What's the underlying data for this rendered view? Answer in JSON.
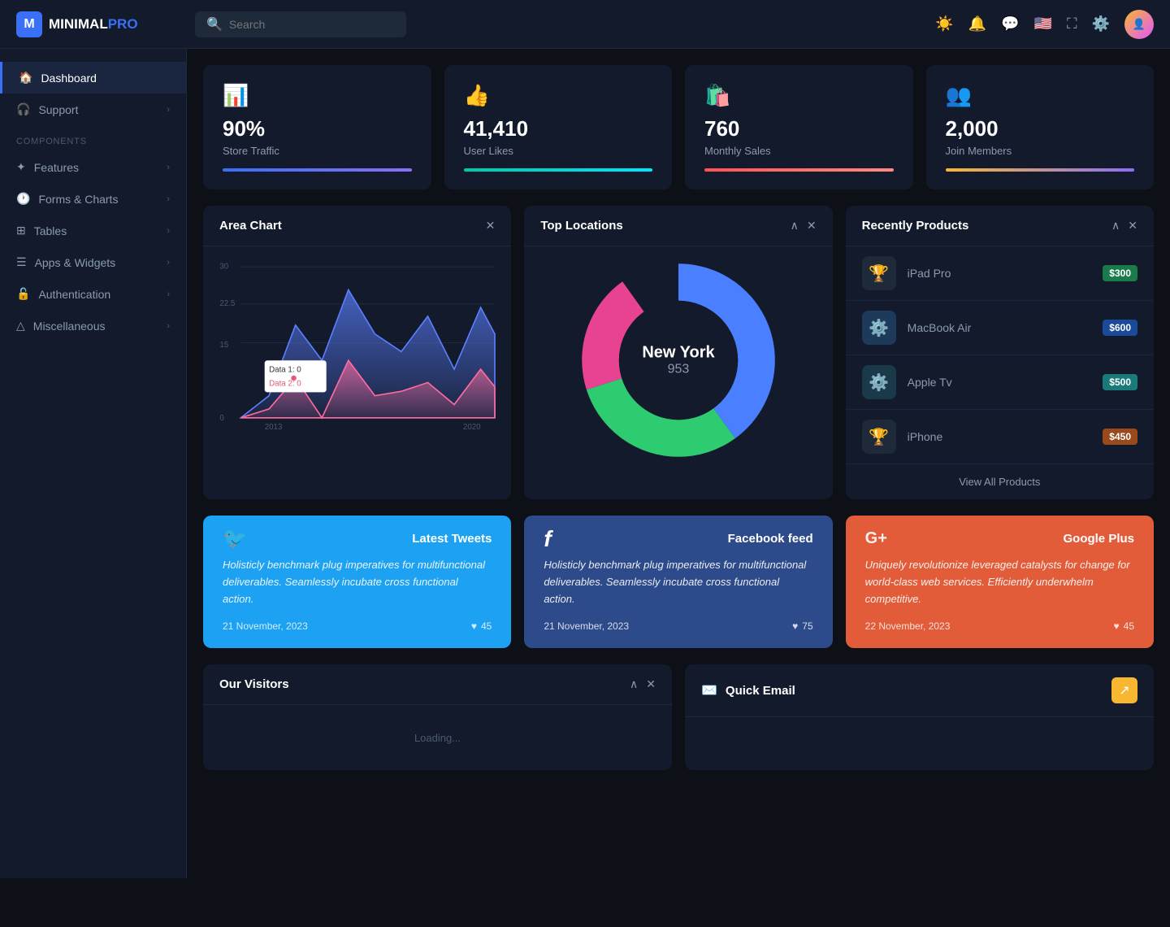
{
  "app": {
    "name_part1": "MINIMAL",
    "name_part2": "PRO"
  },
  "navbar": {
    "search_placeholder": "Search",
    "icons": [
      "☀️",
      "🔔",
      "💬",
      "🇺🇸",
      "⛶",
      "⚙️"
    ]
  },
  "sidebar": {
    "dashboard_label": "Dashboard",
    "support_label": "Support",
    "components_label": "Components",
    "features_label": "Features",
    "forms_charts_label": "Forms & Charts",
    "tables_label": "Tables",
    "apps_widgets_label": "Apps & Widgets",
    "authentication_label": "Authentication",
    "miscellaneous_label": "Miscellaneous"
  },
  "stats": [
    {
      "icon": "📊",
      "value": "90%",
      "label": "Store Traffic",
      "bar_color1": "#3a6ff7",
      "bar_color2": "#8a6ff7"
    },
    {
      "icon": "👍",
      "value": "41,410",
      "label": "User Likes",
      "bar_color1": "#00c9a7",
      "bar_color2": "#00e5ff"
    },
    {
      "icon": "🛍️",
      "value": "760",
      "label": "Monthly Sales",
      "bar_color1": "#ff5252",
      "bar_color2": "#ff8a80"
    },
    {
      "icon": "👥",
      "value": "2,000",
      "label": "Join Members",
      "bar_color1": "#f7b731",
      "bar_color2": "#8a6ff7"
    }
  ],
  "area_chart": {
    "title": "Area Chart",
    "year_label": "2013",
    "year_end": "2020",
    "tooltip_data1_label": "Data 1: 0",
    "tooltip_data2_label": "Data 2: 0",
    "y_labels": [
      "30",
      "22.5",
      "15",
      "0"
    ]
  },
  "top_locations": {
    "title": "Top Locations",
    "city": "New York",
    "city_value": "953"
  },
  "recently_products": {
    "title": "Recently Products",
    "view_all_label": "View All Products",
    "products": [
      {
        "icon": "🏆",
        "name": "iPad Pro",
        "price": "$300",
        "price_class": "price-green"
      },
      {
        "icon": "⚙️",
        "name": "MacBook Air",
        "price": "$600",
        "price_class": "price-blue"
      },
      {
        "icon": "⚙️",
        "name": "Apple Tv",
        "price": "$500",
        "price_class": "price-teal"
      },
      {
        "icon": "🏆",
        "name": "iPhone",
        "price": "$450",
        "price_class": "price-orange"
      }
    ]
  },
  "social_cards": [
    {
      "type": "twitter",
      "css_class": "twitter",
      "logo": "🐦",
      "title": "Latest Tweets",
      "text": "Holisticly benchmark plug imperatives for multifunctional deliverables. Seamlessly incubate cross functional action.",
      "date": "21 November, 2023",
      "likes": "45"
    },
    {
      "type": "facebook",
      "css_class": "facebook",
      "logo": "f",
      "title": "Facebook feed",
      "text": "Holisticly benchmark plug imperatives for multifunctional deliverables. Seamlessly incubate cross functional action.",
      "date": "21 November, 2023",
      "likes": "75"
    },
    {
      "type": "google",
      "css_class": "google",
      "logo": "G+",
      "title": "Google Plus",
      "text": "Uniquely revolutionize leveraged catalysts for change for world-class web services. Efficiently underwhelm competitive.",
      "date": "22 November, 2023",
      "likes": "45"
    }
  ],
  "our_visitors": {
    "title": "Our Visitors"
  },
  "quick_email": {
    "title": "Quick Email",
    "icon": "✉️"
  }
}
